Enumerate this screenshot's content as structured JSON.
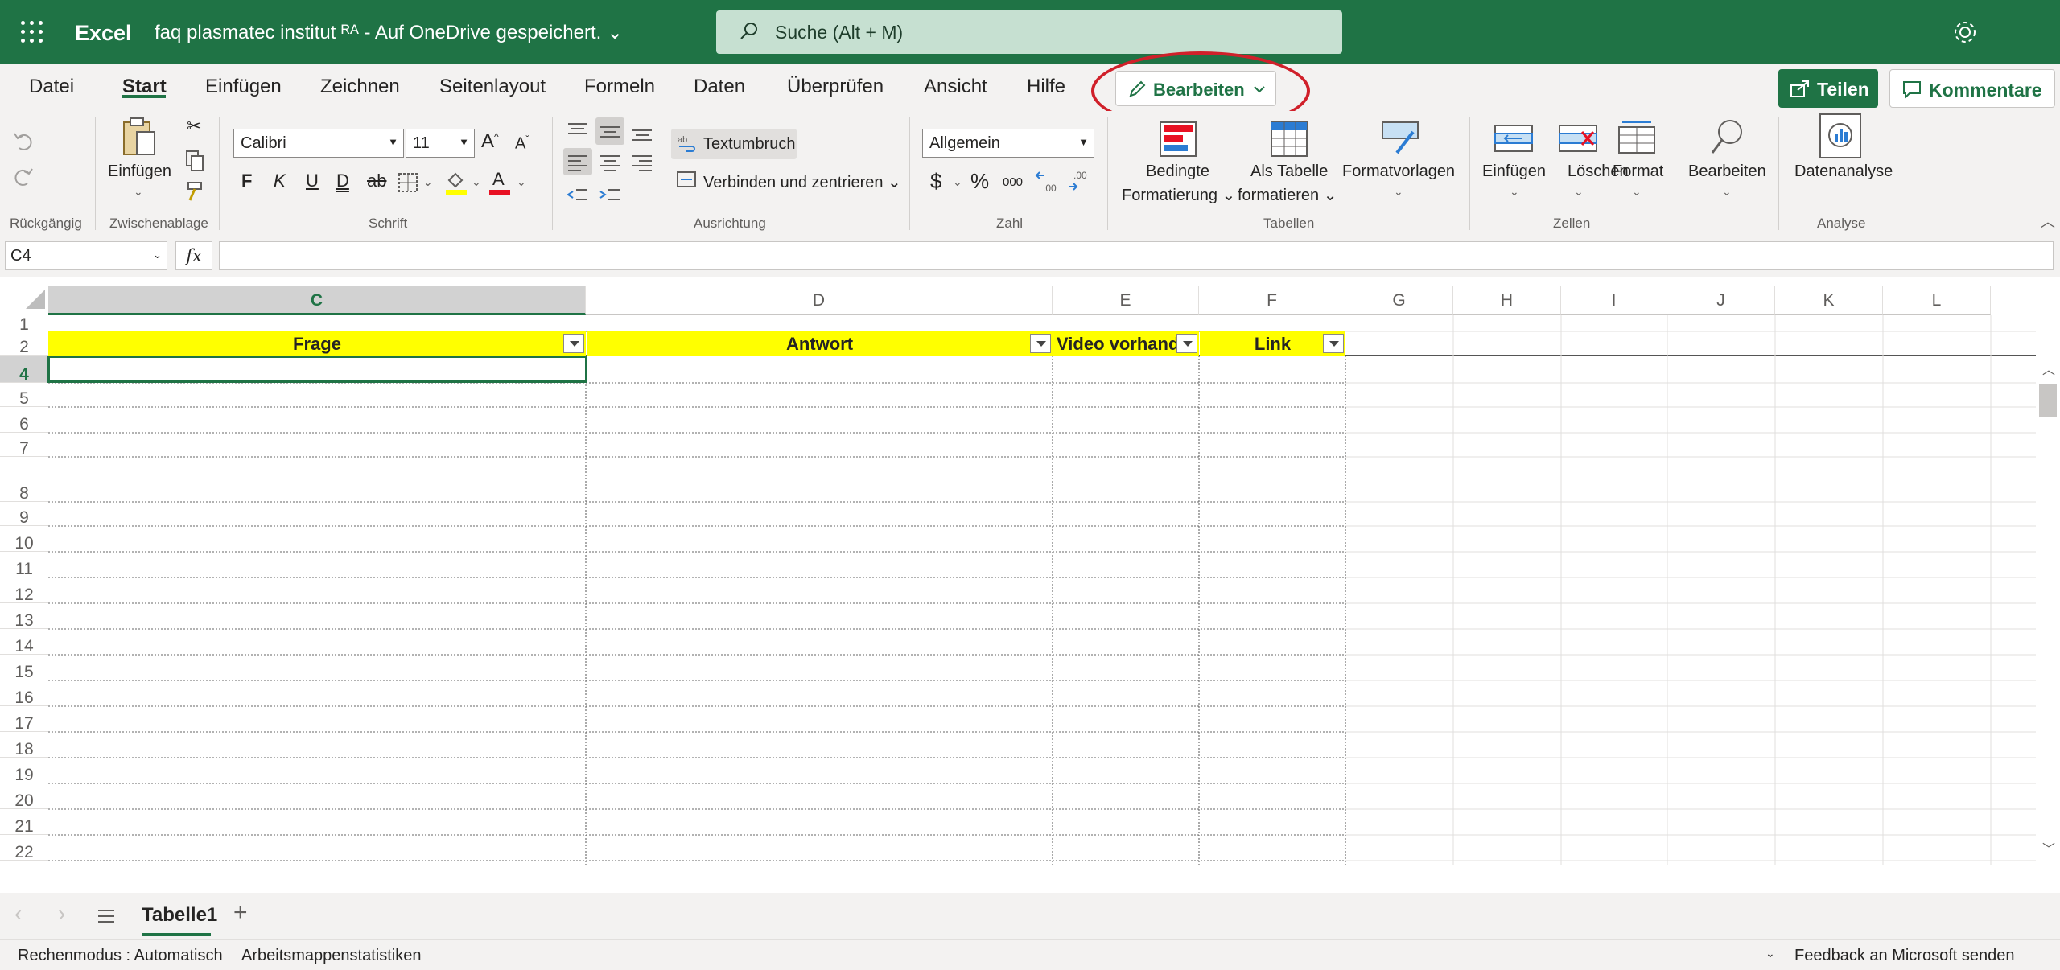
{
  "titlebar": {
    "app_name": "Excel",
    "doc_title": "faq plasmatec institut ᴿᴬ - Auf OneDrive gespeichert. ⌄",
    "search_placeholder": "Suche (Alt + M)"
  },
  "tabs": [
    "Datei",
    "Start",
    "Einfügen",
    "Zeichnen",
    "Seitenlayout",
    "Formeln",
    "Daten",
    "Überprüfen",
    "Ansicht",
    "Hilfe"
  ],
  "active_tab": "Start",
  "edit_mode_label": "Bearbeiten",
  "share_label": "Teilen",
  "comments_label": "Kommentare",
  "ribbon": {
    "groups": {
      "undo": "Rückgängig",
      "clipboard": "Zwischenablage",
      "font": "Schrift",
      "alignment": "Ausrichtung",
      "number": "Zahl",
      "tables": "Tabellen",
      "cells": "Zellen",
      "analysis": "Analyse"
    },
    "paste": "Einfügen",
    "font_name": "Calibri",
    "font_size": "11",
    "bold": "F",
    "italic": "K",
    "underline": "U",
    "double_underline": "D",
    "strikethrough": "ab",
    "wrap_text": "Textumbruch",
    "merge_center": "Verbinden und zentrieren ⌄",
    "number_format": "Allgemein",
    "currency": "$",
    "percent": "%",
    "thousands": "000",
    "cond_format_1": "Bedingte",
    "cond_format_2": "Formatierung ⌄",
    "as_table_1": "Als Tabelle",
    "as_table_2": "formatieren ⌄",
    "styles": "Formatvorlagen",
    "insert": "Einfügen",
    "delete": "Löschen",
    "format": "Format",
    "edit": "Bearbeiten",
    "data_analysis": "Datenanalyse"
  },
  "formula_bar": {
    "name_box": "C4",
    "fx": "fx",
    "formula": ""
  },
  "grid": {
    "columns": [
      "C",
      "D",
      "E",
      "F",
      "G",
      "H",
      "I",
      "J",
      "K",
      "L"
    ],
    "selected_column": "C",
    "rows": [
      "1",
      "2",
      "4",
      "5",
      "6",
      "7",
      "8",
      "9",
      "10",
      "11",
      "12",
      "13",
      "14",
      "15",
      "16",
      "17",
      "18",
      "19",
      "20",
      "21",
      "22"
    ],
    "selected_row": "4",
    "header_cells": [
      "Frage",
      "Antwort",
      "Video vorhand",
      "Link"
    ]
  },
  "sheets": {
    "active": "Tabelle1",
    "add": "+"
  },
  "status": {
    "calc_mode": "Rechenmodus : Automatisch",
    "workbook_stats": "Arbeitsmappenstatistiken",
    "feedback": "Feedback an Microsoft senden"
  },
  "colors": {
    "brand": "#1f7345",
    "header_fill": "#ffff00",
    "highlight_ring": "#d0202a"
  }
}
